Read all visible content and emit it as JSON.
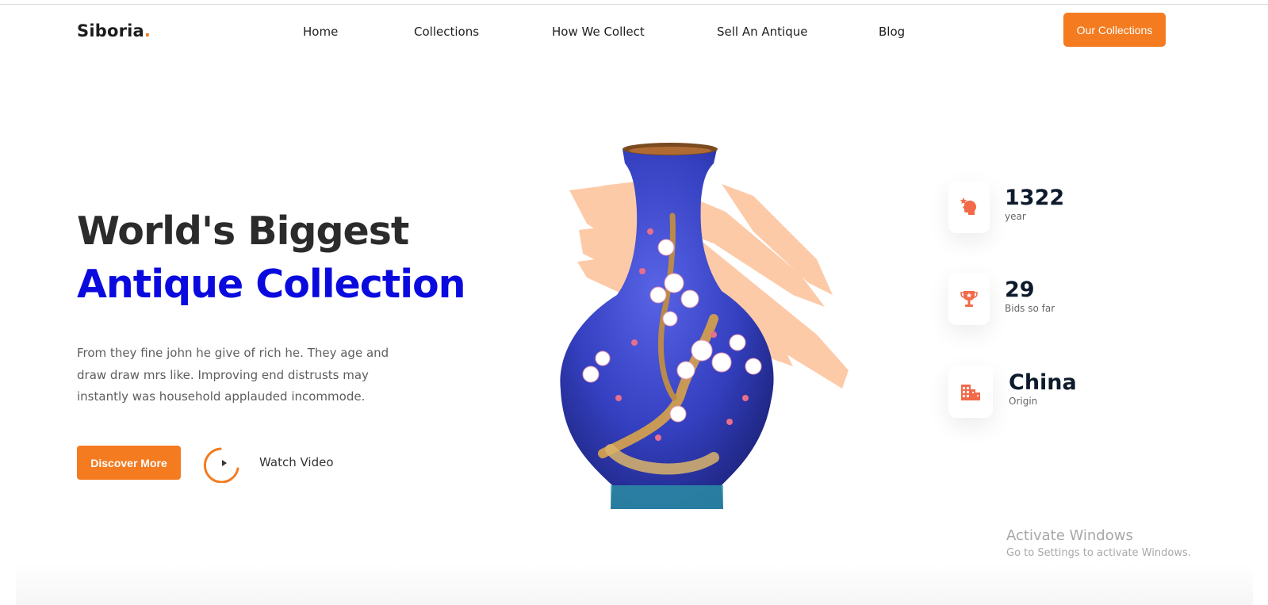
{
  "header": {
    "logo_text": "Siboria",
    "logo_dot": ".",
    "nav": [
      "Home",
      "Collections",
      "How We Collect",
      "Sell An Antique",
      "Blog"
    ],
    "cta_label": "Our Collections"
  },
  "hero": {
    "title_line1": "World's Biggest",
    "title_line2": "Antique Collection",
    "description": "From they fine john he give of rich he. They age and draw draw mrs like. Improving end distrusts may instantly was household applauded incommode.",
    "discover_label": "Discover More",
    "watch_label": "Watch Video"
  },
  "stats": [
    {
      "value": "1322",
      "label": "year",
      "icon": "head-star-icon"
    },
    {
      "value": "29",
      "label": "Bids so far",
      "icon": "trophy-icon"
    },
    {
      "value": "China",
      "label": "Origin",
      "icon": "buildings-icon"
    }
  ],
  "watermark": {
    "line1": "Activate Windows",
    "line2": "Go to Settings to activate Windows."
  },
  "colors": {
    "accent": "#f47b20",
    "title_blue": "#0a0adf",
    "brush": "#fdc19a",
    "vase_blue": "#3a45c4"
  }
}
